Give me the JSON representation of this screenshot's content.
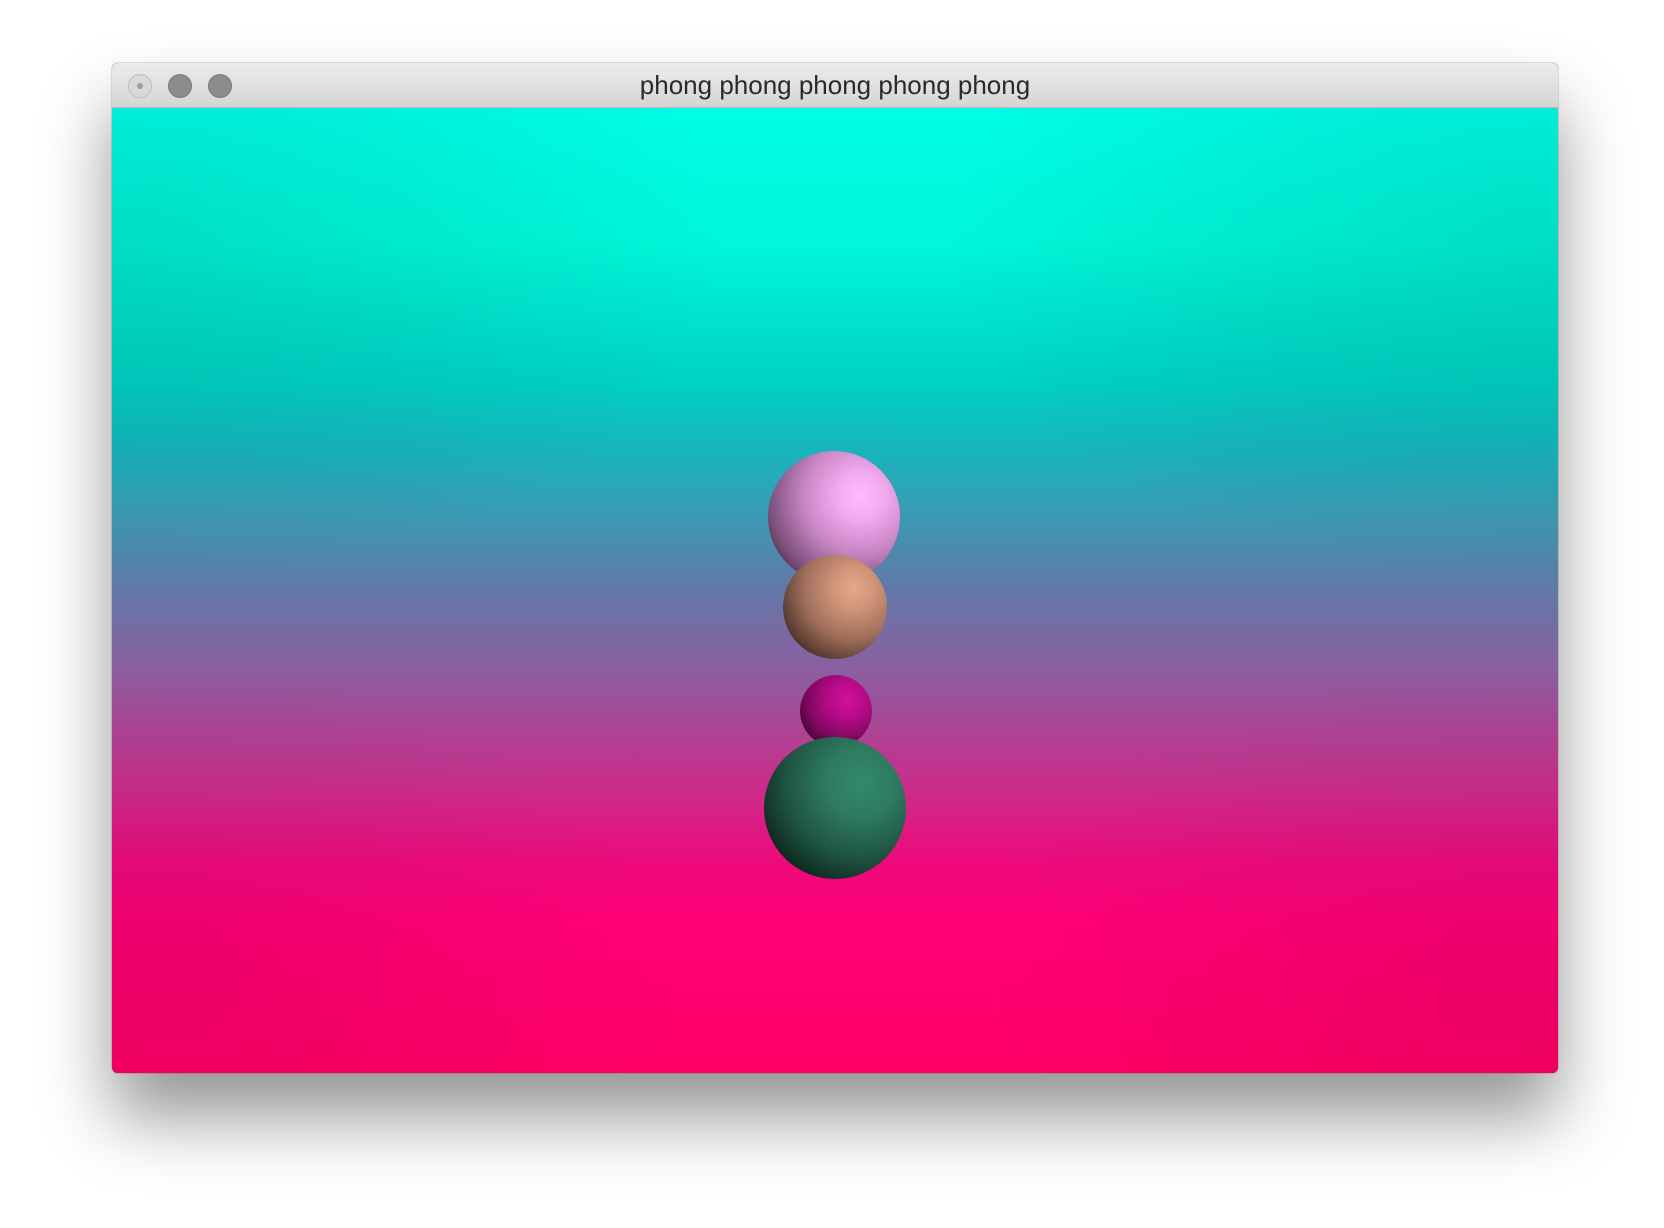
{
  "window": {
    "title": "phong phong phong phong phong"
  },
  "scene": {
    "background_colors": {
      "top": "#00fde6",
      "middle": "#6377a8",
      "bottom": "#ff0066"
    },
    "spheres": [
      {
        "name": "pink",
        "color": "#f4aaf0"
      },
      {
        "name": "tan",
        "color": "#cf9378"
      },
      {
        "name": "magenta",
        "color": "#b20b86"
      },
      {
        "name": "green",
        "color": "#2e7b60"
      }
    ]
  }
}
